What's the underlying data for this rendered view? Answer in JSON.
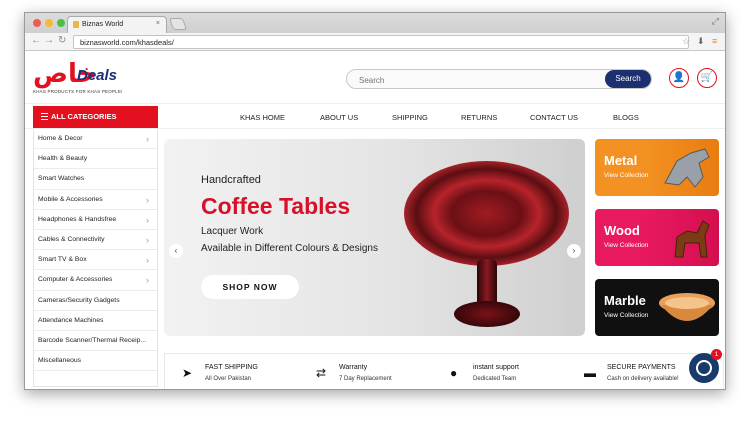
{
  "browser": {
    "tab_title": "Biznas World",
    "tab_close": "×",
    "url": "biznasworld.com/khasdeals/",
    "back_icon": "arrow-left-icon",
    "forward_icon": "arrow-right-icon",
    "reload_icon": "reload-icon"
  },
  "header": {
    "logo_arabic": "خاص",
    "logo_text": "Deals",
    "logo_tagline": "KHAS PRODUCTS FOR KHAS PEOPLE!",
    "search_placeholder": "Search",
    "search_button": "Search"
  },
  "nav": {
    "all_categories": "ALL CATEGORIES",
    "items": [
      "KHAS HOME",
      "ABOUT US",
      "SHIPPING",
      "RETURNS",
      "CONTACT US",
      "BLOGS"
    ]
  },
  "sidebar": {
    "categories": [
      {
        "label": "Home & Decor",
        "chevron": "›"
      },
      {
        "label": "Health & Beauty",
        "chevron": ""
      },
      {
        "label": "Smart Watches",
        "chevron": ""
      },
      {
        "label": "Mobile & Accessories",
        "chevron": "›"
      },
      {
        "label": "Headphones & Handsfree",
        "chevron": "›"
      },
      {
        "label": "Cables & Connectivity",
        "chevron": "›"
      },
      {
        "label": "Smart TV & Box",
        "chevron": "›"
      },
      {
        "label": "Computer & Accessories",
        "chevron": "›"
      },
      {
        "label": "Cameras/Security Gadgets",
        "chevron": ""
      },
      {
        "label": "Attendance Machines",
        "chevron": ""
      },
      {
        "label": "Barcode Scanner/Thermal Receip...",
        "chevron": ""
      },
      {
        "label": "Miscellaneous",
        "chevron": ""
      }
    ]
  },
  "banner": {
    "small": "Handcrafted",
    "title": "Coffee Tables",
    "line1": "Lacquer Work",
    "line2": "Available in Different Colours & Designs",
    "button": "SHOP NOW",
    "prev": "‹",
    "next": "›"
  },
  "tiles": [
    {
      "title": "Metal",
      "sub": "View Collection",
      "color": "#f39222"
    },
    {
      "title": "Wood",
      "sub": "View Collection",
      "color": "#e8195f"
    },
    {
      "title": "Marble",
      "sub": "View Collection",
      "color": "#101010"
    }
  ],
  "features": [
    {
      "title": "FAST SHIPPING",
      "sub": "All Over Pakistan",
      "icon": "paper-plane-icon"
    },
    {
      "title": "Warranty",
      "sub": "7 Day Replacement",
      "icon": "exchange-icon"
    },
    {
      "title": "instant support",
      "sub": "Dedicated Team",
      "icon": "chat-bubble-icon"
    },
    {
      "title": "SECURE PAYMENTS",
      "sub": "Cash on delivery available!",
      "icon": "credit-card-icon"
    }
  ],
  "chat": {
    "badge": "1"
  },
  "colors": {
    "brand_red": "#e3101f",
    "navy": "#1c2f6e"
  }
}
